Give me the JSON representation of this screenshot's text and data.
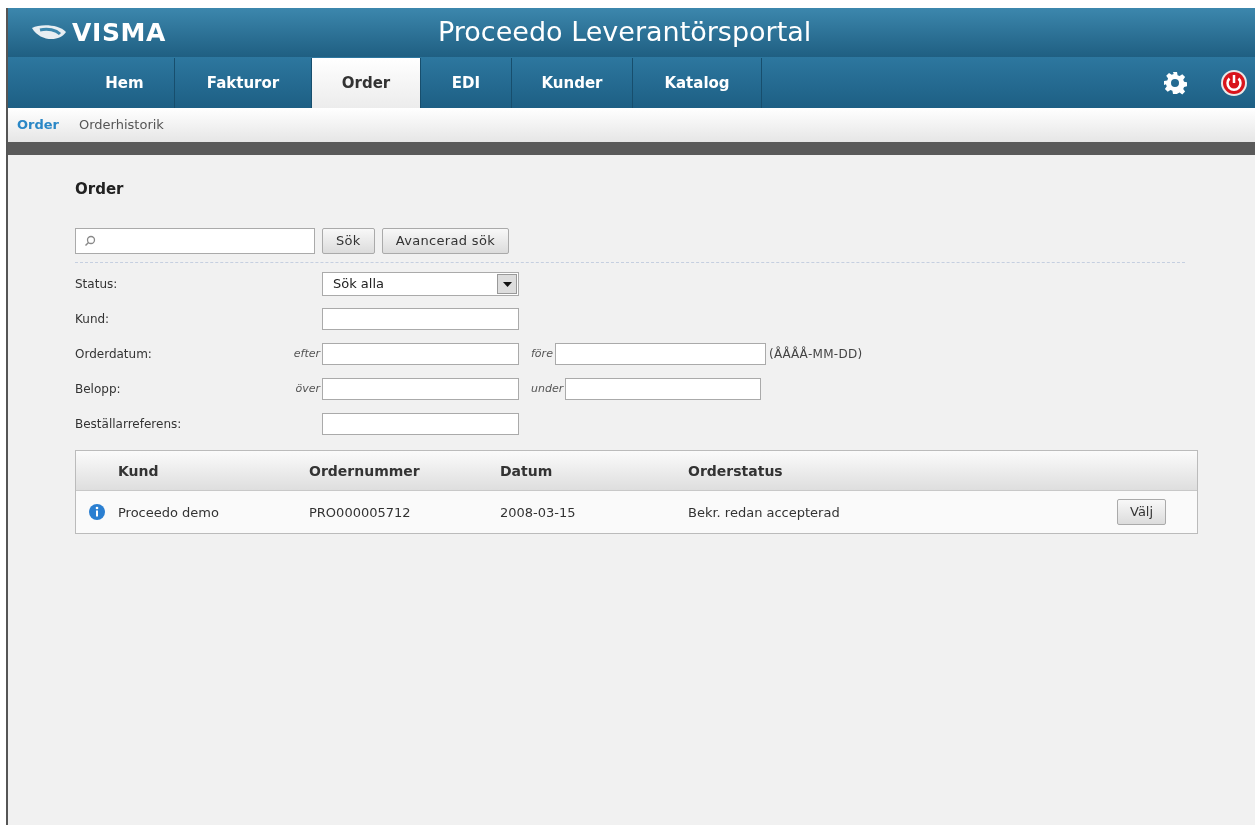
{
  "header": {
    "logo": "VISMA",
    "title": "Proceedo Leverantörsportal"
  },
  "nav_tabs": [
    {
      "label": "Hem",
      "selected": false
    },
    {
      "label": "Fakturor",
      "selected": false
    },
    {
      "label": "Order",
      "selected": true
    },
    {
      "label": "EDI",
      "selected": false
    },
    {
      "label": "Kunder",
      "selected": false
    },
    {
      "label": "Katalog",
      "selected": false
    }
  ],
  "sub_nav": [
    {
      "label": "Order",
      "selected": true
    },
    {
      "label": "Orderhistorik",
      "selected": false
    }
  ],
  "page_title": "Order",
  "search": {
    "buttons": [
      "Sök",
      "Avancerad sök"
    ]
  },
  "filters": [
    {
      "label": "Status:",
      "kind": "select",
      "value": "Sök alla"
    },
    {
      "label": "Kund:",
      "kind": "text"
    },
    {
      "label": "Orderdatum:",
      "kind": "range",
      "from_label": "efter",
      "to_label": "före",
      "hint": "(ÅÅÅÅ-MM-DD)"
    },
    {
      "label": "Belopp:",
      "kind": "range",
      "from_label": "över",
      "to_label": "under"
    },
    {
      "label": "Beställarreferens:",
      "kind": "text"
    }
  ],
  "table": {
    "columns": [
      "Kund",
      "Ordernummer",
      "Datum",
      "Orderstatus"
    ],
    "rows": [
      {
        "cells": [
          "Proceedo demo",
          "PRO000005712",
          "2008-03-15",
          "Bekr. redan accepterad"
        ],
        "button": "Välj"
      }
    ]
  }
}
